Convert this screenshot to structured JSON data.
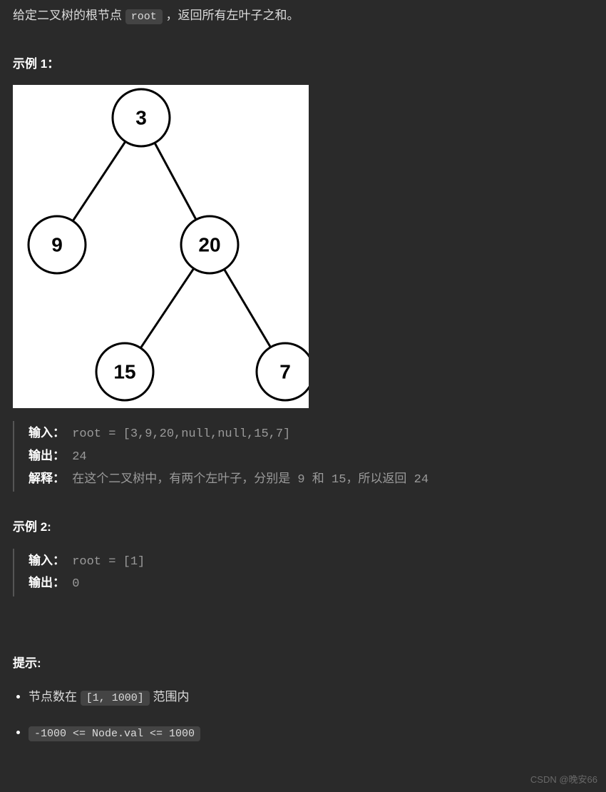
{
  "description": {
    "part1": "给定二叉树的根节点 ",
    "code": "root",
    "part2": " ，返回所有左叶子之和。"
  },
  "example1": {
    "heading": "示例 1：",
    "tree": {
      "node_root": "3",
      "node_left": "9",
      "node_right": "20",
      "node_right_left": "15",
      "node_right_right": "7"
    },
    "input_label": "输入：",
    "input_value": " root = [3,9,20,null,null,15,7]",
    "output_label": "输出：",
    "output_value": " 24",
    "explain_label": "解释：",
    "explain_value": " 在这个二叉树中，有两个左叶子，分别是 9 和 15，所以返回 24"
  },
  "example2": {
    "heading": "示例 2:",
    "input_label": "输入：",
    "input_value": " root = [1]",
    "output_label": "输出：",
    "output_value": " 0"
  },
  "hints": {
    "heading": "提示:",
    "item1_text": "节点数在 ",
    "item1_code": "[1, 1000]",
    "item1_text2": " 范围内",
    "item2_code": "-1000 <= Node.val <= 1000"
  },
  "watermark": "CSDN @晚安66"
}
